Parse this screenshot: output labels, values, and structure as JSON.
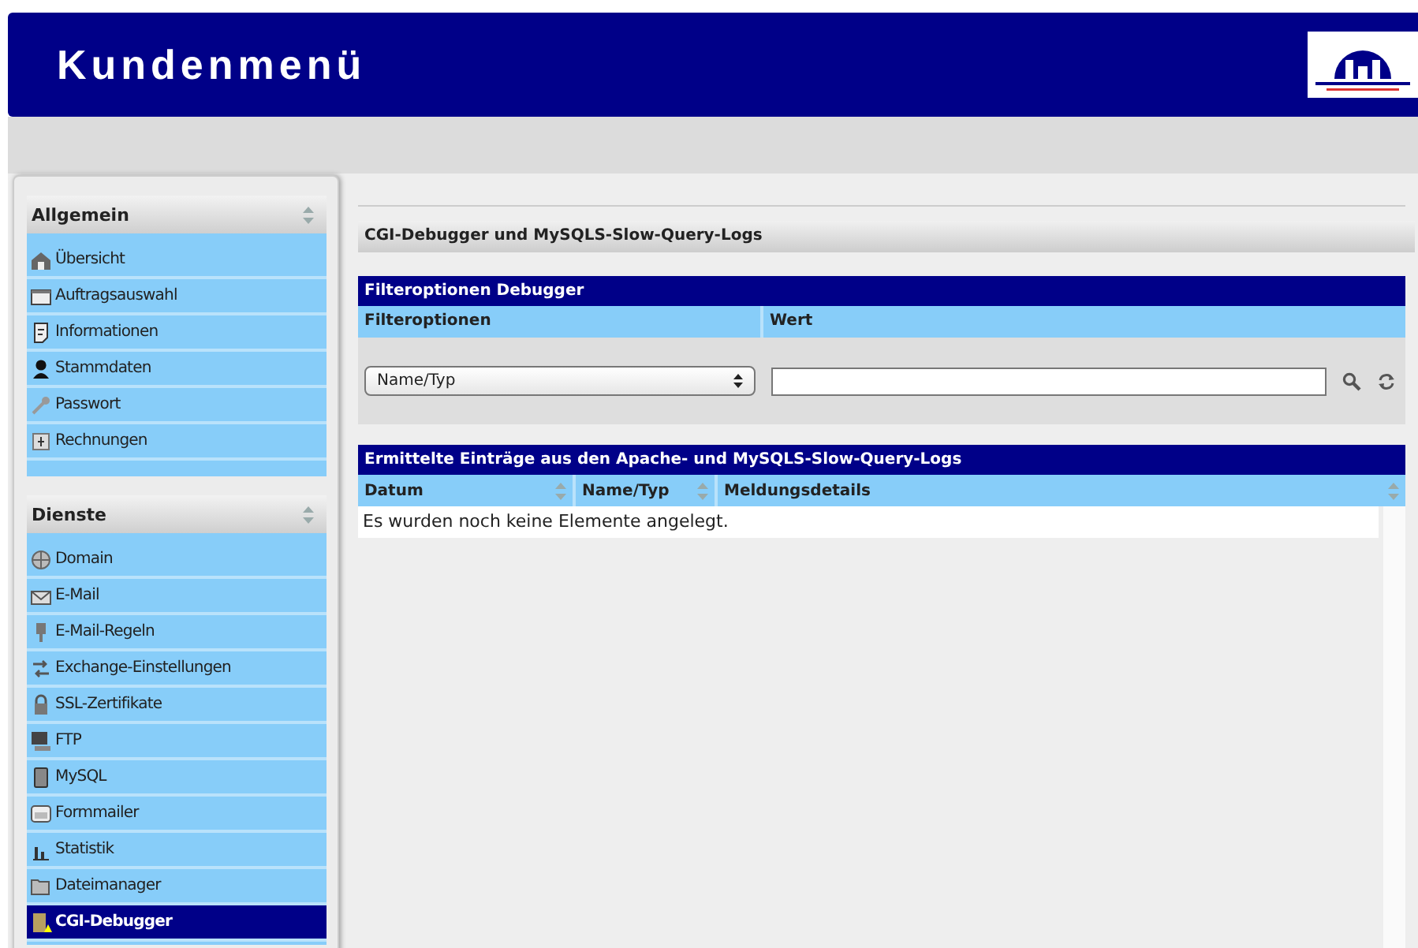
{
  "header": {
    "title": "Kundenmenü"
  },
  "sidebar": {
    "sections": [
      {
        "title": "Allgemein",
        "items": [
          {
            "label": "Übersicht",
            "selected": false
          },
          {
            "label": "Auftragsauswahl",
            "selected": false
          },
          {
            "label": "Informationen",
            "selected": false
          },
          {
            "label": "Stammdaten",
            "selected": false
          },
          {
            "label": "Passwort",
            "selected": false
          },
          {
            "label": "Rechnungen",
            "selected": false
          }
        ]
      },
      {
        "title": "Dienste",
        "items": [
          {
            "label": "Domain",
            "selected": false
          },
          {
            "label": "E-Mail",
            "selected": false
          },
          {
            "label": "E-Mail-Regeln",
            "selected": false
          },
          {
            "label": "Exchange-Einstellungen",
            "selected": false
          },
          {
            "label": "SSL-Zertifikate",
            "selected": false
          },
          {
            "label": "FTP",
            "selected": false
          },
          {
            "label": "MySQL",
            "selected": false
          },
          {
            "label": "Formmailer",
            "selected": false
          },
          {
            "label": "Statistik",
            "selected": false
          },
          {
            "label": "Dateimanager",
            "selected": false
          },
          {
            "label": "CGI-Debugger",
            "selected": true
          }
        ]
      }
    ]
  },
  "page_title": "CGI-Debugger und MySQLS-Slow-Query-Logs",
  "filter": {
    "title": "Filteroptionen Debugger",
    "columns": [
      "Filteroptionen",
      "Wert"
    ],
    "select_value": "Name/Typ"
  },
  "results": {
    "title": "Ermittelte Einträge aus den Apache- und MySQLS-Slow-Query-Logs",
    "columns": [
      "Datum",
      "Name/Typ",
      "Meldungsdetails"
    ],
    "empty_message": "Es wurden noch keine Elemente angelegt."
  }
}
